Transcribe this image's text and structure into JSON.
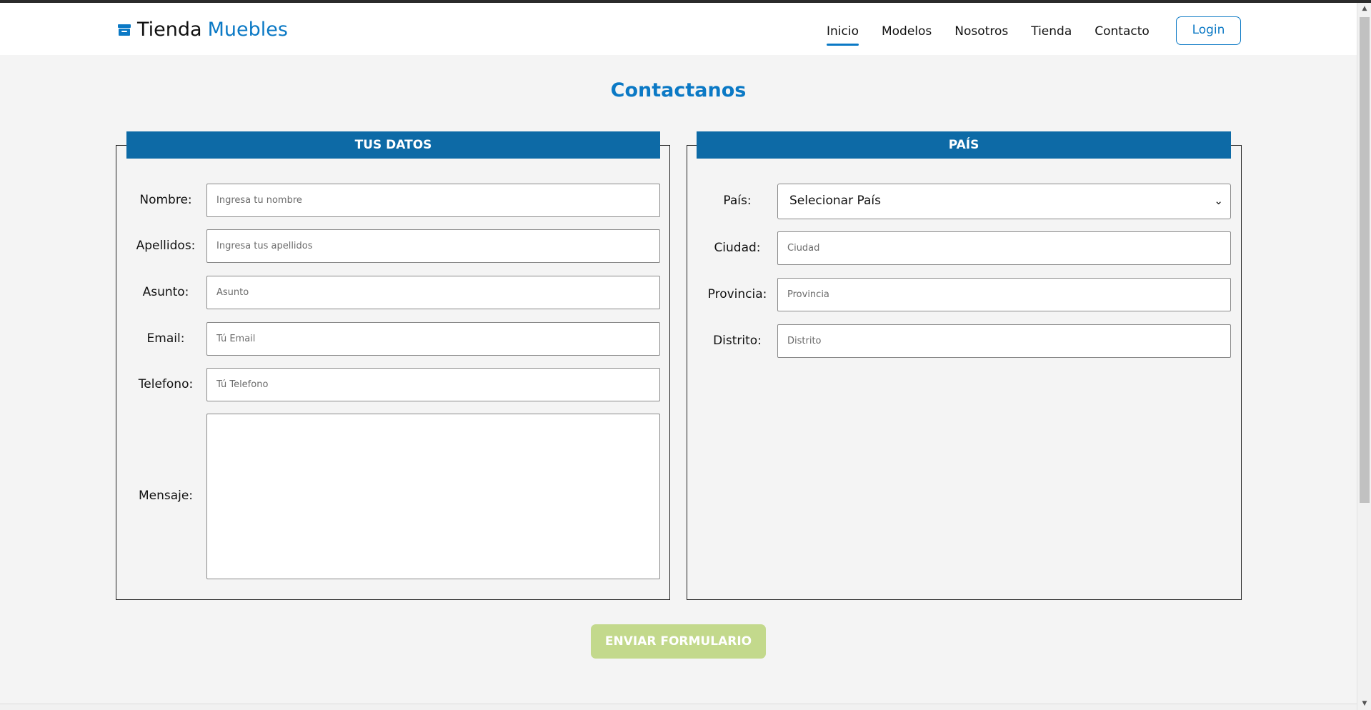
{
  "header": {
    "brand_part1": "Tienda",
    "brand_part2": "Muebles",
    "brand_icon": "archive-box-icon",
    "nav": [
      {
        "label": "Inicio",
        "active": true
      },
      {
        "label": "Modelos",
        "active": false
      },
      {
        "label": "Nosotros",
        "active": false
      },
      {
        "label": "Tienda",
        "active": false
      },
      {
        "label": "Contacto",
        "active": false
      }
    ],
    "login_label": "Login"
  },
  "title": "Contactanos",
  "left_panel": {
    "legend": "TUS DATOS",
    "fields": {
      "nombre": {
        "label": "Nombre:",
        "placeholder": "Ingresa tu nombre",
        "value": ""
      },
      "apellidos": {
        "label": "Apellidos:",
        "placeholder": "Ingresa tus apellidos",
        "value": ""
      },
      "asunto": {
        "label": "Asunto:",
        "placeholder": "Asunto",
        "value": ""
      },
      "email": {
        "label": "Email:",
        "placeholder": "Tú Email",
        "value": ""
      },
      "telefono": {
        "label": "Telefono:",
        "placeholder": "Tú Telefono",
        "value": ""
      },
      "mensaje": {
        "label": "Mensaje:",
        "value": ""
      }
    }
  },
  "right_panel": {
    "legend": "PAÍS",
    "fields": {
      "pais": {
        "label": "País:",
        "selected": "Selecionar País"
      },
      "ciudad": {
        "label": "Ciudad:",
        "placeholder": "Ciudad",
        "value": ""
      },
      "provincia": {
        "label": "Provincia:",
        "placeholder": "Provincia",
        "value": ""
      },
      "distrito": {
        "label": "Distrito:",
        "placeholder": "Distrito",
        "value": ""
      }
    }
  },
  "submit_label": "ENVIAR FORMULARIO",
  "colors": {
    "accent": "#0b79c5",
    "legend_bg": "#0d6aa6",
    "submit_bg": "#c3d98c",
    "page_bg": "#f4f4f4"
  }
}
